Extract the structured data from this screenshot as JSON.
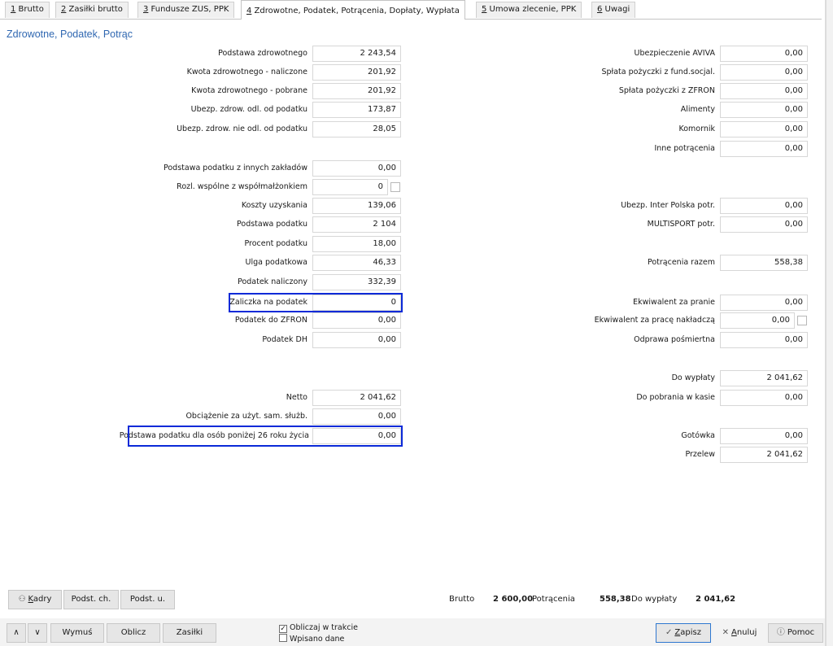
{
  "tabs": [
    {
      "acc": "1",
      "rest": " Brutto"
    },
    {
      "acc": "2",
      "rest": " Zasiłki brutto"
    },
    {
      "acc": "3",
      "rest": " Fundusze ZUS, PPK"
    },
    {
      "acc": "4",
      "rest": " Zdrowotne, Podatek, Potrącenia, Dopłaty, Wypłata"
    },
    {
      "acc": "5",
      "rest": " Umowa zlecenie, PPK"
    },
    {
      "acc": "6",
      "rest": " Uwagi"
    }
  ],
  "section_title": "Zdrowotne, Podatek, Potrąc",
  "left": {
    "podstawa_zdrowotnego": {
      "label": "Podstawa zdrowotnego",
      "value": "2 243,54"
    },
    "kwota_zdrow_naliczone": {
      "label": "Kwota zdrowotnego - naliczone",
      "value": "201,92"
    },
    "kwota_zdrow_pobrane": {
      "label": "Kwota zdrowotnego - pobrane",
      "value": "201,92"
    },
    "ubezp_odl": {
      "label": "Ubezp. zdrow. odl. od podatku",
      "value": "173,87"
    },
    "ubezp_nie_odl": {
      "label": "Ubezp. zdrow. nie odl. od podatku",
      "value": "28,05"
    },
    "podstawa_inne": {
      "label": "Podstawa podatku z innych zakładów",
      "value": "0,00"
    },
    "rozl_wspolne": {
      "label": "Rozl. wspólne z współmałżonkiem",
      "value": "0"
    },
    "koszty": {
      "label": "Koszty uzyskania",
      "value": "139,06"
    },
    "podstawa_podatku": {
      "label": "Podstawa podatku",
      "value": "2 104"
    },
    "procent": {
      "label": "Procent podatku",
      "value": "18,00"
    },
    "ulga": {
      "label": "Ulga podatkowa",
      "value": "46,33"
    },
    "podatek_naliczony": {
      "label": "Podatek naliczony",
      "value": "332,39"
    },
    "zaliczka": {
      "label": "Zaliczka na podatek",
      "value": "0"
    },
    "podatek_zfron": {
      "label": "Podatek do ZFRON",
      "value": "0,00"
    },
    "podatek_dh": {
      "label": "Podatek DH",
      "value": "0,00"
    },
    "netto": {
      "label": "Netto",
      "value": "2 041,62"
    },
    "obciazenie": {
      "label": "Obciążenie za użyt. sam. służb.",
      "value": "0,00"
    },
    "podstawa_26": {
      "label": "Podstawa podatku dla osób poniżej 26 roku życia",
      "value": "0,00"
    }
  },
  "right": {
    "aviva": {
      "label": "Ubezpieczenie AVIVA",
      "value": "0,00"
    },
    "splata_fund": {
      "label": "Spłata pożyczki z fund.socjal.",
      "value": "0,00"
    },
    "splata_zfron": {
      "label": "Spłata pożyczki z ZFRON",
      "value": "0,00"
    },
    "alimenty": {
      "label": "Alimenty",
      "value": "0,00"
    },
    "komornik": {
      "label": "Komornik",
      "value": "0,00"
    },
    "inne": {
      "label": "Inne potrącenia",
      "value": "0,00"
    },
    "inter_polska": {
      "label": "Ubezp. Inter Polska potr.",
      "value": "0,00"
    },
    "multisport": {
      "label": "MULTISPORT potr.",
      "value": "0,00"
    },
    "potracenia_razem": {
      "label": "Potrącenia razem",
      "value": "558,38"
    },
    "ekw_pranie": {
      "label": "Ekwiwalent za pranie",
      "value": "0,00"
    },
    "ekw_praca": {
      "label": "Ekwiwalent za pracę nakładczą",
      "value": "0,00"
    },
    "odprawa": {
      "label": "Odprawa pośmiertna",
      "value": "0,00"
    },
    "do_wyplaty": {
      "label": "Do wypłaty",
      "value": "2 041,62"
    },
    "do_pobrania": {
      "label": "Do pobrania w kasie",
      "value": "0,00"
    },
    "gotowka": {
      "label": "Gotówka",
      "value": "0,00"
    },
    "przelew": {
      "label": "Przelew",
      "value": "2 041,62"
    }
  },
  "toolbar": {
    "kadry_acc": "K",
    "kadry_rest": "adry",
    "podst_ch": "Podst. ch.",
    "podst_u": "Podst. u."
  },
  "summary": {
    "brutto_label": "Brutto",
    "brutto_value": "2 600,00",
    "potracenia_label": "Potrącenia",
    "potracenia_value": "558,38",
    "do_wyplaty_label": "Do wypłaty",
    "do_wyplaty_value": "2 041,62"
  },
  "bottom": {
    "wymus": "Wymuś",
    "oblicz": "Oblicz",
    "zasilki": "Zasiłki",
    "oblicz_w_trakcie": "Obliczaj w trakcie",
    "wpisano_dane": "Wpisano dane",
    "zapisz_acc": "Z",
    "zapisz_rest": "apisz",
    "anuluj_acc": "A",
    "anuluj_rest": "nuluj",
    "pomoc": "Pomoc"
  }
}
